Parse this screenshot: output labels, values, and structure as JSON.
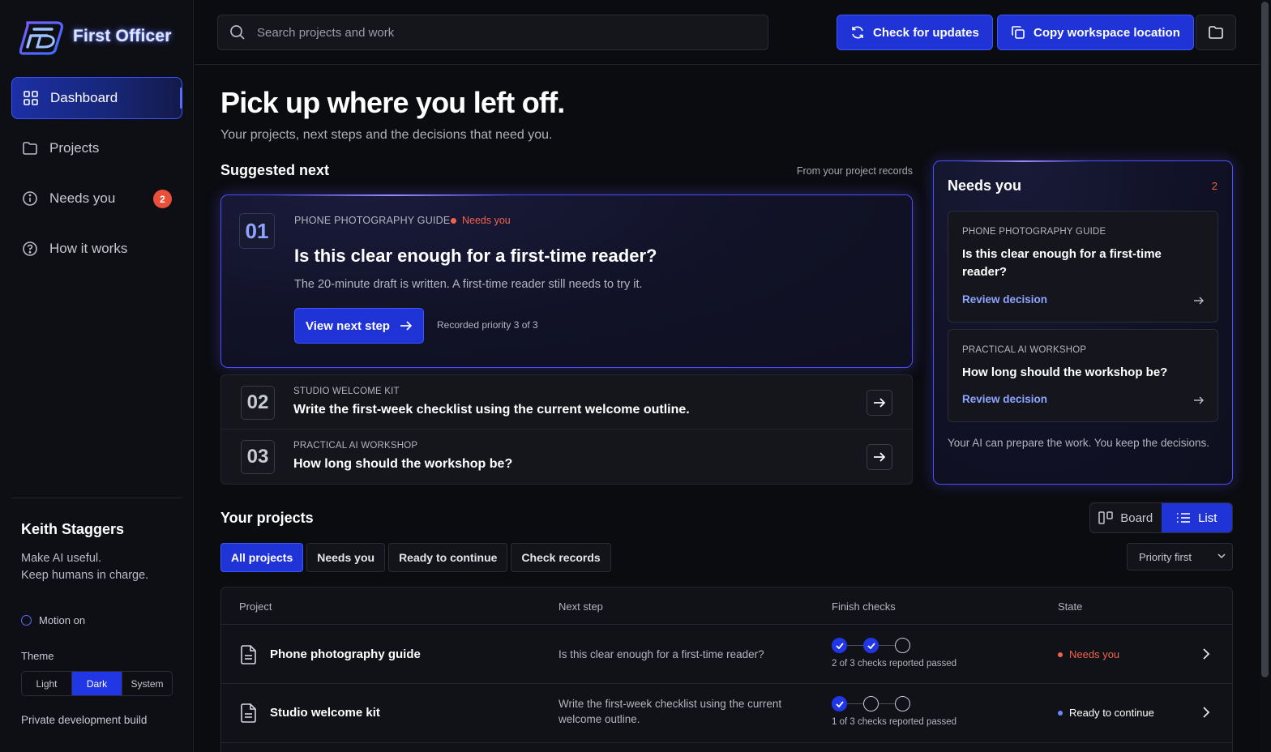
{
  "app": {
    "name": "First Officer"
  },
  "colors": {
    "accent": "#1f33d6",
    "danger": "#f0624a",
    "ready": "#6d86ff",
    "bg": "#0b0c10"
  },
  "sidebar": {
    "items": [
      {
        "label": "Dashboard",
        "icon": "grid-icon",
        "active": true
      },
      {
        "label": "Projects",
        "icon": "folder-icon"
      },
      {
        "label": "Needs you",
        "icon": "info-icon",
        "badge": "2"
      },
      {
        "label": "How it works",
        "icon": "help-icon"
      }
    ],
    "user": {
      "name": "Keith Staggers",
      "tagline_1": "Make AI useful.",
      "tagline_2": "Keep humans in charge."
    },
    "motion": "Motion on",
    "theme_label": "Theme",
    "theme_options": [
      "Light",
      "Dark",
      "System"
    ],
    "theme_selected": "Dark",
    "build": "Private development build"
  },
  "topbar": {
    "search_placeholder": "Search projects and work",
    "check_updates": "Check for updates",
    "copy_location": "Copy workspace location"
  },
  "main": {
    "headline": "Pick up where you left off.",
    "subhead": "Your projects, next steps and the decisions that need you.",
    "suggested_title": "Suggested next",
    "suggested_note": "From your project records",
    "featured": {
      "num": "01",
      "project": "PHONE PHOTOGRAPHY GUIDE",
      "tag": "Needs you",
      "question": "Is this clear enough for a first-time reader?",
      "desc": "The 20-minute draft is written. A first-time reader still needs to try it.",
      "button": "View next step",
      "priority": "Recorded priority 3 of 3"
    },
    "rows": [
      {
        "num": "02",
        "project": "STUDIO WELCOME KIT",
        "title": "Write the first-week checklist using the current welcome outline."
      },
      {
        "num": "03",
        "project": "PRACTICAL AI WORKSHOP",
        "title": "How long should the workshop be?"
      }
    ]
  },
  "needs_panel": {
    "title": "Needs you",
    "count": "2",
    "items": [
      {
        "project": "PHONE PHOTOGRAPHY GUIDE",
        "question": "Is this clear enough for a first-time reader?",
        "link": "Review decision"
      },
      {
        "project": "PRACTICAL AI WORKSHOP",
        "question": "How long should the workshop be?",
        "link": "Review decision"
      }
    ],
    "footer": "Your AI can prepare the work. You keep the decisions."
  },
  "projects": {
    "title": "Your projects",
    "view_board": "Board",
    "view_list": "List",
    "view_selected": "List",
    "filters": [
      "All projects",
      "Needs you",
      "Ready to continue",
      "Check records"
    ],
    "filter_selected": "All projects",
    "sort": "Priority first",
    "columns": [
      "Project",
      "Next step",
      "Finish checks",
      "State"
    ],
    "rows": [
      {
        "name": "Phone photography guide",
        "next": "Is this clear enough for a first-time reader?",
        "checks_passed": 2,
        "checks_total": 3,
        "checks_note": "2 of 3 checks reported passed",
        "state": "Needs you",
        "state_color": "#f0624a"
      },
      {
        "name": "Studio welcome kit",
        "next": "Write the first-week checklist using the current welcome outline.",
        "checks_passed": 1,
        "checks_total": 3,
        "checks_note": "1 of 3 checks reported passed",
        "state": "Ready to continue",
        "state_color": "#6d86ff"
      }
    ]
  }
}
